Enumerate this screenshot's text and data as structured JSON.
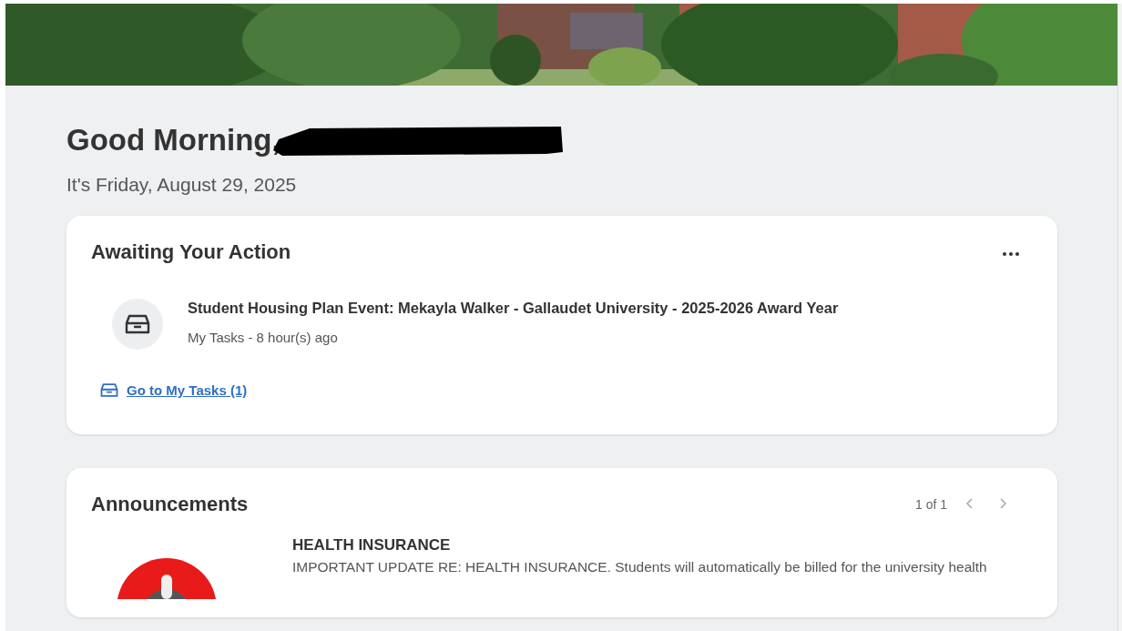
{
  "greeting": {
    "text": "Good Morning,",
    "redacted": true
  },
  "date": "It's Friday, August 29, 2025",
  "awaiting": {
    "title": "Awaiting Your Action",
    "tasks": [
      {
        "title": "Student Housing Plan Event: Mekayla Walker - Gallaudet University - 2025-2026 Award Year",
        "meta": "My Tasks - 8 hour(s) ago"
      }
    ],
    "link": "Go to My Tasks (1)"
  },
  "announcements": {
    "title": "Announcements",
    "pager": "1 of 1",
    "pager_buttons": [
      {
        "kind": "prev",
        "disabled": true
      },
      {
        "kind": "next",
        "disabled": true
      }
    ],
    "items": [
      {
        "title": "HEALTH INSURANCE",
        "body": "IMPORTANT UPDATE RE: HEALTH INSURANCE. Students will automatically be billed for the university health"
      }
    ]
  }
}
